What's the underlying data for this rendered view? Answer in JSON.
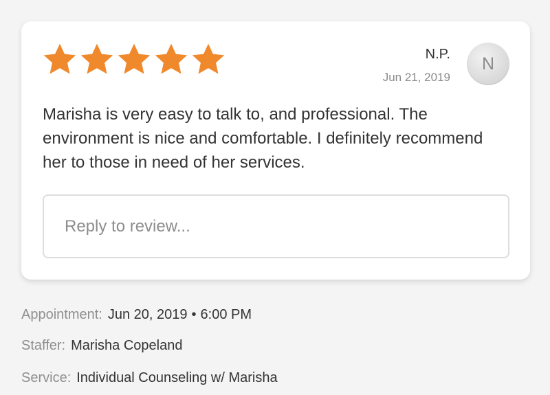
{
  "review": {
    "rating": 5,
    "rating_max": 5,
    "star_color": "#f0892c",
    "reviewer_name": "N.P.",
    "date": "Jun 21, 2019",
    "avatar_initial": "N",
    "text": "Marisha is very easy to talk to, and professional. The environment is nice and comfortable. I definitely recommend her to those in need of her services.",
    "reply_placeholder": "Reply to review..."
  },
  "details": {
    "appointment_label": "Appointment:",
    "appointment_date": "Jun 20, 2019",
    "separator": "•",
    "appointment_time": "6:00 PM",
    "staffer_label": "Staffer:",
    "staffer_value": "Marisha Copeland",
    "service_label": "Service:",
    "service_value": "Individual Counseling w/ Marisha"
  }
}
